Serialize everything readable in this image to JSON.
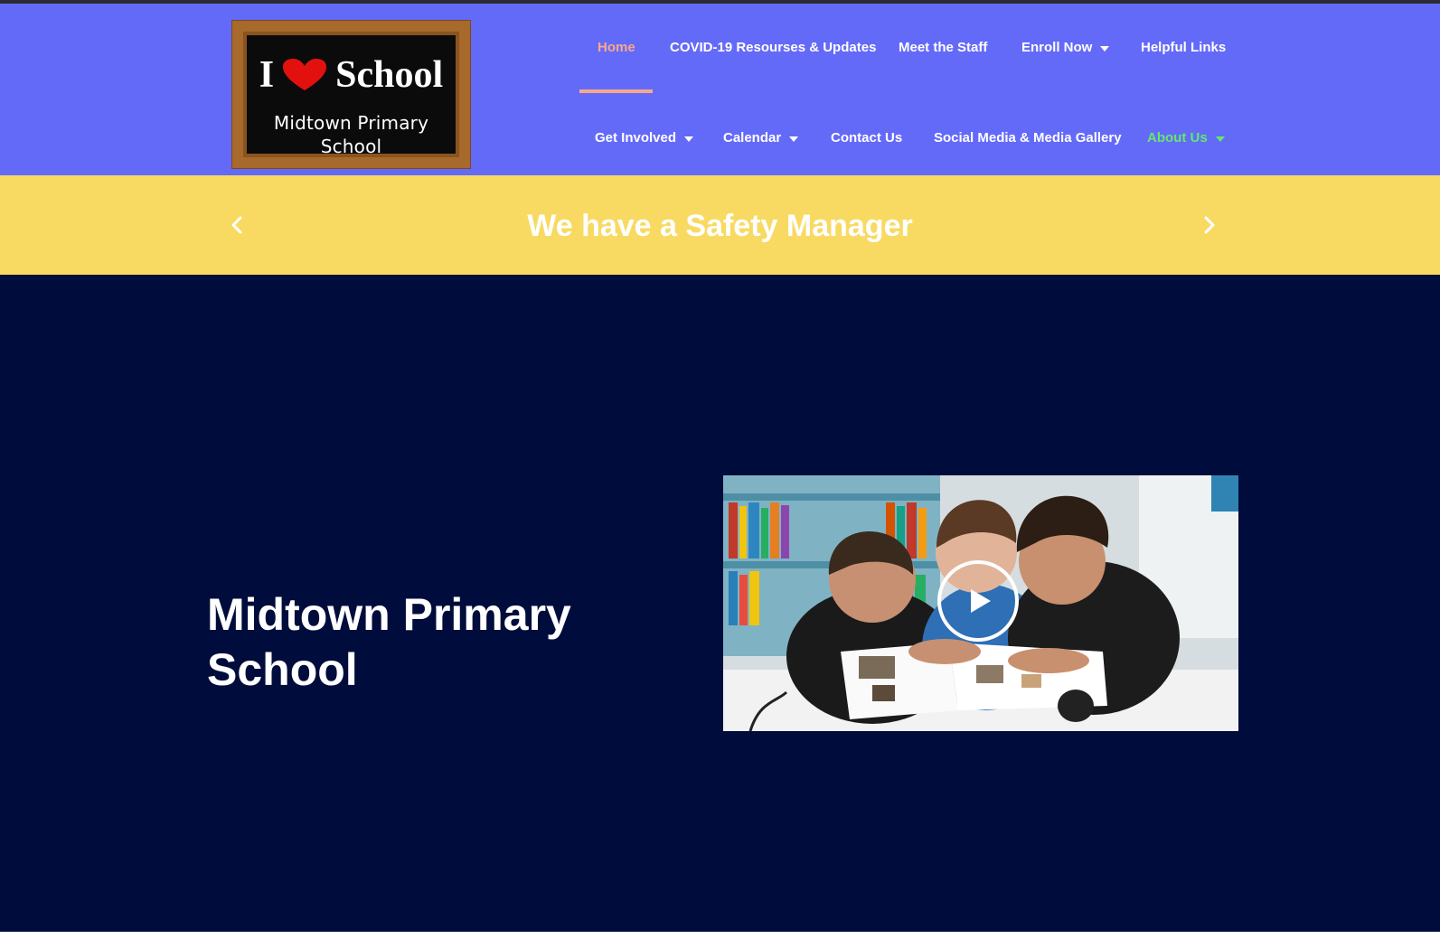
{
  "colors": {
    "header_bg": "#646af8",
    "banner_bg": "#f8da63",
    "hero_bg": "#000c3c",
    "home_accent": "#f7a88b",
    "about_accent": "#64e86b"
  },
  "logo": {
    "line1_left": "I",
    "line1_right": "School",
    "line2": "Midtown Primary School",
    "heart_icon": "heart-icon"
  },
  "nav": {
    "row1": [
      {
        "label": "Home",
        "has_dropdown": false
      },
      {
        "label": "COVID-19 Resourses & Updates",
        "has_dropdown": false
      },
      {
        "label": "Meet the Staff",
        "has_dropdown": false
      },
      {
        "label": "Enroll Now",
        "has_dropdown": true
      },
      {
        "label": "Helpful Links",
        "has_dropdown": false
      }
    ],
    "row2": [
      {
        "label": "Get Involved",
        "has_dropdown": true
      },
      {
        "label": "Calendar",
        "has_dropdown": true
      },
      {
        "label": "Contact Us",
        "has_dropdown": false
      },
      {
        "label": "Social Media & Media Gallery",
        "has_dropdown": false
      },
      {
        "label": "About Us",
        "has_dropdown": true
      }
    ]
  },
  "banner": {
    "title": "We have a Safety Manager",
    "prev_icon": "chevron-left-icon",
    "next_icon": "chevron-right-icon"
  },
  "hero": {
    "title": "Midtown Primary School",
    "video_icon": "play-icon"
  }
}
